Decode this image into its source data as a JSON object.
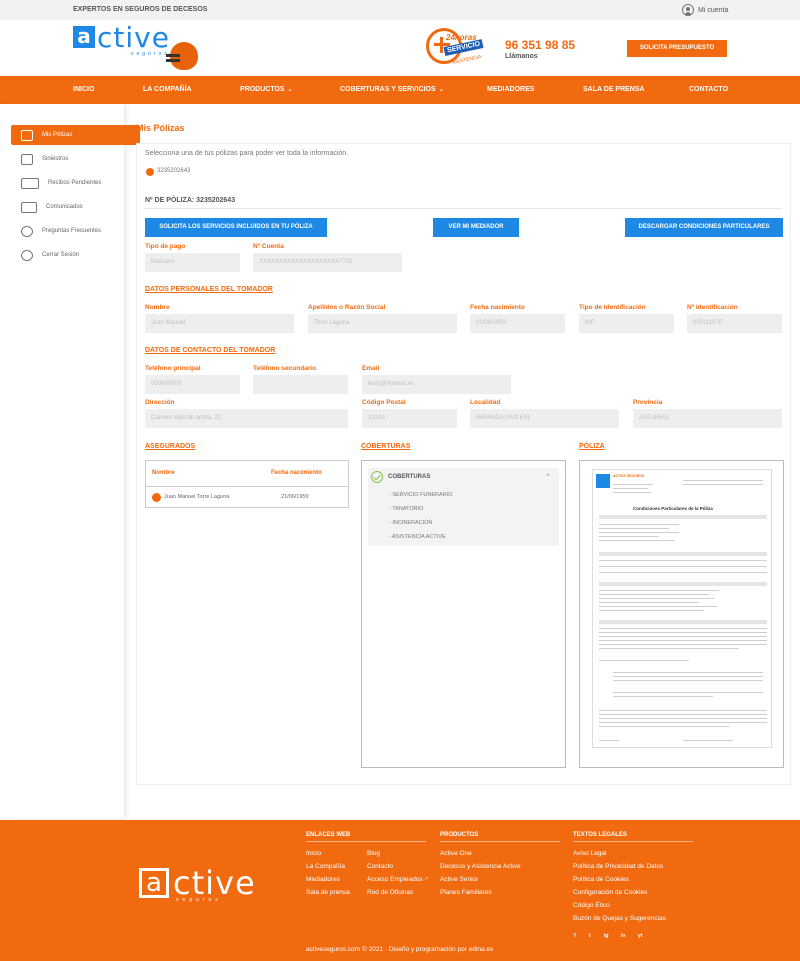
{
  "topbar": {
    "tagline": "EXPERTOS EN SEGUROS DE DECESOS",
    "account": "Mi cuenta"
  },
  "header": {
    "logo_word": "ctive",
    "logo_letter": "a",
    "logo_sub": "seguros",
    "badge_hours": "24horas",
    "badge_service": "SERVICIO",
    "badge_assist": "ASISTENCIA",
    "phone": "96 351 98 85",
    "call": "Llámanos",
    "quote_button": "SOLICITA PRESUPUESTO"
  },
  "nav": [
    "INICIO",
    "LA COMPAÑÍA",
    "PRODUCTOS",
    "COBERTURAS Y SERVICIOS",
    "MEDIADORES",
    "SALA DE PRENSA",
    "CONTACTO"
  ],
  "sidebar": [
    {
      "label": "Mis Pólizas",
      "icon": "document-icon",
      "active": true
    },
    {
      "label": "Siniestros",
      "icon": "clipboard-icon",
      "active": false
    },
    {
      "label": "Recibos Pendientes",
      "icon": "receipt-icon",
      "active": false
    },
    {
      "label": "Comunicados",
      "icon": "message-icon",
      "active": false
    },
    {
      "label": "Preguntas Frecuentes",
      "icon": "question-icon",
      "active": false
    },
    {
      "label": "Cerrar Sesión",
      "icon": "power-icon",
      "active": false
    }
  ],
  "main": {
    "title": "Mis Pólizas",
    "select_text": "Selecciona una de tus pólizas para poder ver toda la información.",
    "policy_option": "3235202643",
    "policy_number": "Nº DE PÓLIZA: 3235202643",
    "buttons": {
      "services": "SOLICITA LOS SERVICIOS INCLUIDOS EN TU PÓLIZA",
      "mediator": "VER MI MEDIADOR",
      "download": "DESCARGAR CONDICIONES PARTICULARES"
    },
    "payment": {
      "type_label": "Tipo de pago",
      "type_value": "Bancario",
      "account_label": "Nº Cuenta",
      "account_value": "XXXXXXXXXXXXXXXXXXXX7722"
    },
    "personal": {
      "title": "DATOS PERSONALES DEL TOMADOR",
      "name_label": "Nombre",
      "name_value": "Juan Manuel",
      "surname_label": "Apellidos o Razón Social",
      "surname_value": "Torre Laguna",
      "birth_label": "Fecha nacimiento",
      "birth_value": "21/06/1959",
      "idtype_label": "Tipo de identificación",
      "idtype_value": "NIF",
      "id_label": "Nº identificación",
      "id_value": "00011167P"
    },
    "contact": {
      "title": "DATOS DE CONTACTO DEL TOMADOR",
      "phone1_label": "Teléfono principal",
      "phone1_value": "000000000",
      "phone2_label": "Teléfono secundario",
      "phone2_value": "",
      "email_label": "Email",
      "email_value": "tests@hotmail.es",
      "address_label": "Dirección",
      "address_value": "Camino viejo de arriba, 21",
      "zip_label": "Código Postal",
      "zip_value": "33100",
      "city_label": "Localidad",
      "city_value": "MIRANDA (AVILES)",
      "province_label": "Provincia",
      "province_value": "ASTURIAS"
    },
    "insured": {
      "title": "ASEGURADOS",
      "col_name": "Nombre",
      "col_birth": "Fecha nacimiento",
      "row_name": "Juan Manuel Torre Laguna",
      "row_birth": "21/06/1959"
    },
    "coverage": {
      "title": "COBERTURAS",
      "header": "COBERTURAS",
      "items": [
        "- SERVICIO FUNERARIO",
        "- TANATORIO",
        "- INCINERACIÓN",
        "- ASISTENCIA ACTIVE"
      ]
    },
    "policy": {
      "title": "PÓLIZA",
      "doc_header": "ACTIVE SEGUROS",
      "doc_title": "Condiciones Particulares de la Póliza"
    }
  },
  "footer": {
    "logo_letter": "a",
    "logo_word": "ctive",
    "logo_sub": "seguros",
    "links_title": "ENLACES WEB",
    "links_col1": [
      "Inicio",
      "La Compañía",
      "Mediadores",
      "Sala de prensa"
    ],
    "links_col2": [
      "Blog",
      "Contacto",
      "Acceso Empleados",
      "Red de Oficinas"
    ],
    "products_title": "PRODUCTOS",
    "products": [
      "Active One",
      "Decesos y Asistencia Active",
      "Active Senior",
      "Planes Familiares"
    ],
    "legal_title": "TEXTOS LEGALES",
    "legal": [
      "Aviso Legal",
      "Política de Privacidad de Datos",
      "Política de Cookies",
      "Configuración de Cookies",
      "Código Ético",
      "Buzón de Quejas y Sugerencias"
    ],
    "social": [
      "f",
      "t",
      "ig",
      "in",
      "yt"
    ],
    "copyright": "activeseguros.com © 2021 · Diseño y programación por edina.es"
  }
}
